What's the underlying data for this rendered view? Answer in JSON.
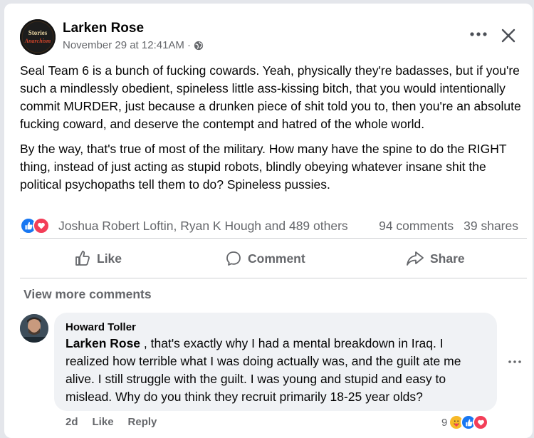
{
  "post": {
    "author": "Larken Rose",
    "timestamp": "November 29 at 12:41AM",
    "separator": "·",
    "paragraphs": [
      "Seal Team 6 is a bunch of fucking cowards. Yeah, physically they're badasses, but if you're such a mindlessly obedient, spineless little ass-kissing bitch, that you would intentionally commit MURDER, just because a drunken piece of shit told you to, then you're an absolute fucking coward, and deserve the contempt and hatred of the whole world.",
      "By the way, that's true of most of the military. How many have the spine to do the RIGHT thing, instead of just acting as stupid robots, blindly obeying whatever insane shit the political psychopaths tell them to do? Spineless pussies."
    ],
    "reaction_names": "Joshua Robert Loftin, Ryan K Hough and 489 others",
    "comments_count": "94 comments",
    "shares_count": "39 shares",
    "avatar_text": "Larken Rose"
  },
  "actions": {
    "like": "Like",
    "comment": "Comment",
    "share": "Share"
  },
  "comments_section": {
    "view_more": "View more comments"
  },
  "comment": {
    "author": "Howard Toller",
    "mention": "Larken Rose",
    "text": " , that's exactly why I had a mental breakdown in Iraq. I realized how terrible what I was doing actually was, and the guilt ate me alive. I still struggle with the guilt. I was young and stupid and easy to mislead. Why do you think they recruit primarily 18-25 year olds?",
    "age": "2d",
    "like": "Like",
    "reply": "Reply",
    "reaction_count": "9"
  },
  "colors": {
    "like_blue": "#1877f2",
    "love_red": "#f33e58",
    "care_yellow": "#f7b928",
    "muted_text": "#65676b"
  }
}
